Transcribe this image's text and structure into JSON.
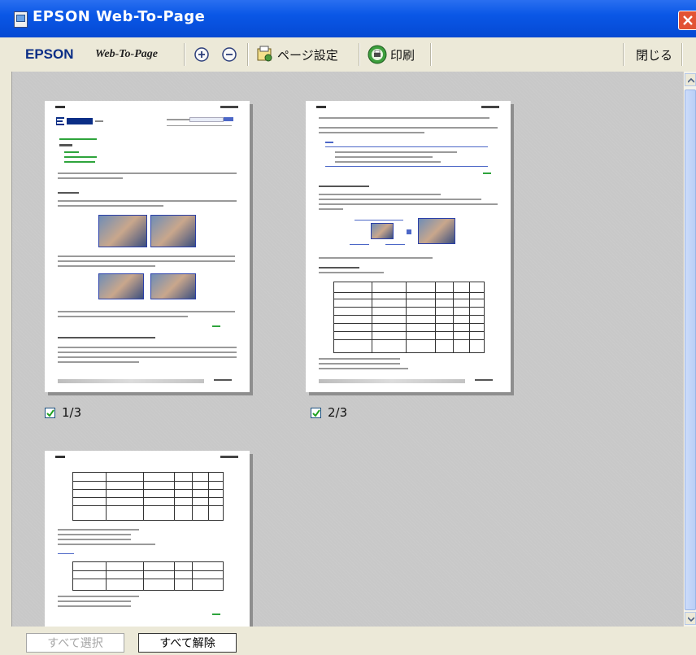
{
  "window": {
    "title": "EPSON Web-To-Page"
  },
  "toolbar": {
    "brand": "EPSON",
    "product": "Web-To-Page",
    "page_setup_label": "ページ設定",
    "print_label": "印刷",
    "close_label": "閉じる"
  },
  "pages": [
    {
      "label": "1/3",
      "checked": true
    },
    {
      "label": "2/3",
      "checked": true
    }
  ],
  "footer": {
    "select_all_label": "すべて選択",
    "deselect_all_label": "すべて解除"
  },
  "colors": {
    "titlebar": "#0a57e6",
    "brand": "#0b2e86",
    "viewport": "#c8c8c8"
  }
}
